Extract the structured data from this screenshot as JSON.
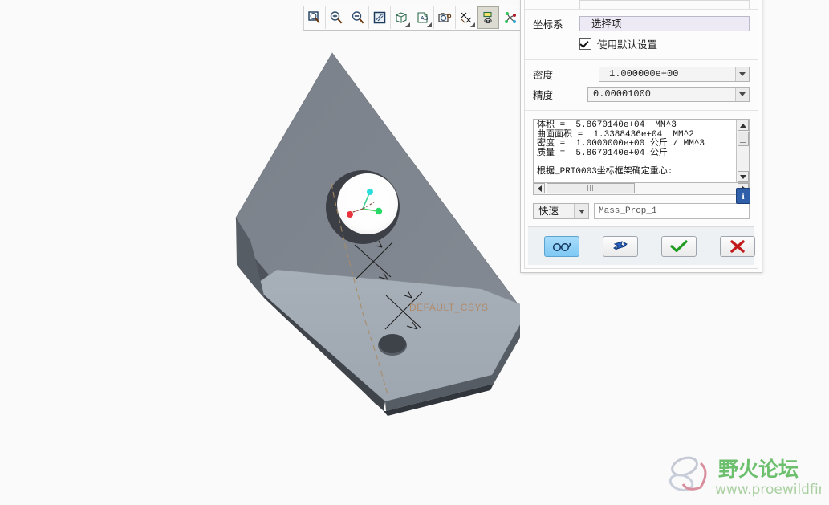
{
  "app": {
    "canvas_bg": "#fafafa"
  },
  "toolbar": {
    "buttons": [
      {
        "name": "zoom-window-icon",
        "title": "重画/放大区域"
      },
      {
        "name": "zoom-in-icon",
        "title": "放大"
      },
      {
        "name": "zoom-out-icon",
        "title": "缩小"
      },
      {
        "name": "repaint-icon",
        "title": "重画"
      },
      {
        "name": "display-style-icon",
        "title": "显示样式"
      },
      {
        "name": "annotation-display-icon",
        "title": "注释显示"
      },
      {
        "name": "screenshot-icon",
        "title": "保存图像"
      },
      {
        "name": "datum-display-icon",
        "title": "基准显示"
      },
      {
        "name": "csys-display-icon",
        "title": "坐标系显示",
        "active": true
      },
      {
        "name": "point-display-icon",
        "title": "点显示"
      }
    ]
  },
  "model": {
    "csys_label": "DEFAULT_CSYS",
    "face_color": "#7e848c",
    "top_face_color": "#6f757e",
    "side_dark_color": "#4d525a",
    "bottom_face_color": "#a9b1ba",
    "axis_colors": {
      "x": "#e8333c",
      "y": "#2ad86a",
      "z": "#2adcdc"
    }
  },
  "dialog": {
    "csys": {
      "label": "坐标系",
      "selector_value": "选择项",
      "checkbox_label": "使用默认设置",
      "checkbox_checked": true
    },
    "density": {
      "label": "密度",
      "value": "1.000000e+00"
    },
    "accuracy": {
      "label": "精度",
      "value": "0.00001000"
    },
    "results": {
      "lines": "体积 =  5.8670140e+04  MM^3\n曲面面积 =  1.3388436e+04  MM^2\n密度 =  1.0000000e+00 公斤 / MM^3\n质量 =  5.8670140e+04 公斤\n\n根据_PRT0003坐标框架确定重心:",
      "info_icon": "i"
    },
    "name_row": {
      "type_value": "快速",
      "name_value": "Mass_Prop_1"
    },
    "footer": {
      "preview_label": "预览",
      "refresh_label": "重新计算",
      "ok_label": "确定",
      "cancel_label": "取消"
    }
  },
  "watermark": {
    "title": "野火论坛",
    "url": "www.proewildfire.cn",
    "title_color": "#6cbf6c",
    "url_color": "#a9cfa0"
  }
}
